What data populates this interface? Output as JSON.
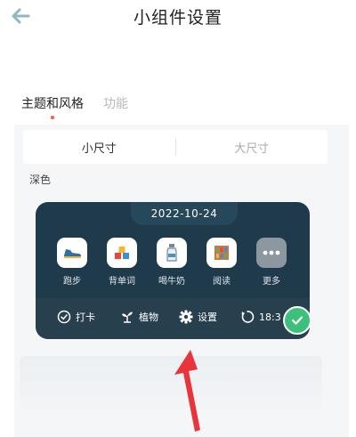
{
  "header": {
    "title": "小组件设置",
    "back_icon": "back-arrow-icon"
  },
  "tabs": [
    {
      "label": "主题和风格",
      "active": true
    },
    {
      "label": "功能",
      "active": false
    }
  ],
  "size_options": [
    {
      "label": "小尺寸",
      "selected": true
    },
    {
      "label": "大尺寸",
      "selected": false
    }
  ],
  "theme": {
    "label": "深色"
  },
  "widget": {
    "date": "2022-10-24",
    "habits": [
      {
        "label": "跑步",
        "icon": "running-shoe-icon"
      },
      {
        "label": "背单词",
        "icon": "vocabulary-blocks-icon"
      },
      {
        "label": "喝牛奶",
        "icon": "milk-bottle-icon"
      },
      {
        "label": "阅读",
        "icon": "bookshelf-icon"
      },
      {
        "label": "更多",
        "icon": "more-dots-icon"
      }
    ],
    "actions": [
      {
        "label": "打卡",
        "icon": "check-circle-icon"
      },
      {
        "label": "植物",
        "icon": "plant-sprout-icon"
      },
      {
        "label": "设置",
        "icon": "gear-icon"
      },
      {
        "label": "18:3",
        "icon": "refresh-icon"
      }
    ]
  },
  "colors": {
    "accent": "#ff5a3c",
    "widget_background": "#1f3a4b",
    "widget_bar": "#283f4e",
    "selected_check": "#3ec07a",
    "annotation_arrow": "#e8353b"
  }
}
